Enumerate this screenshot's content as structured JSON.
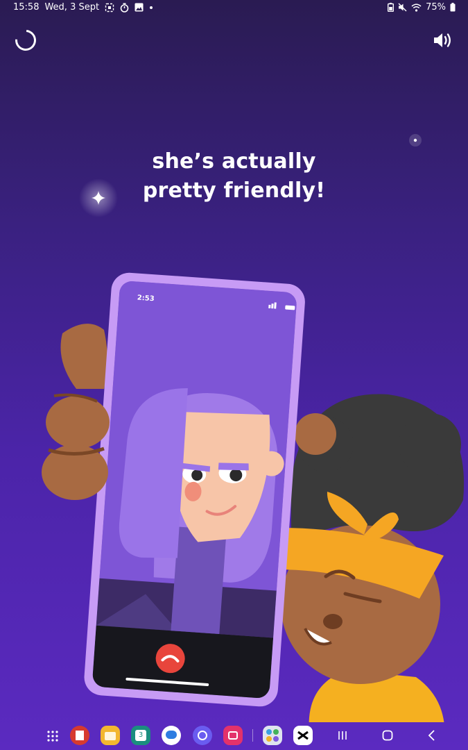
{
  "status_bar": {
    "time": "15:58",
    "date": "Wed, 3 Sept",
    "battery": "75%"
  },
  "lesson": {
    "caption": "she’s actually pretty friendly!"
  },
  "phone_screen": {
    "time": "2:53"
  },
  "dock": {
    "apps": [
      "app-drawer",
      "flipboard",
      "notes",
      "calendar",
      "messages",
      "internet",
      "screen-recorder",
      "app-folder",
      "capcut"
    ]
  },
  "colors": {
    "background_top": "#2a1b52",
    "background_bottom": "#5b2ac0",
    "phone_frame": "#c79bf5",
    "hangup": "#e8453c",
    "headband": "#f5a623"
  }
}
